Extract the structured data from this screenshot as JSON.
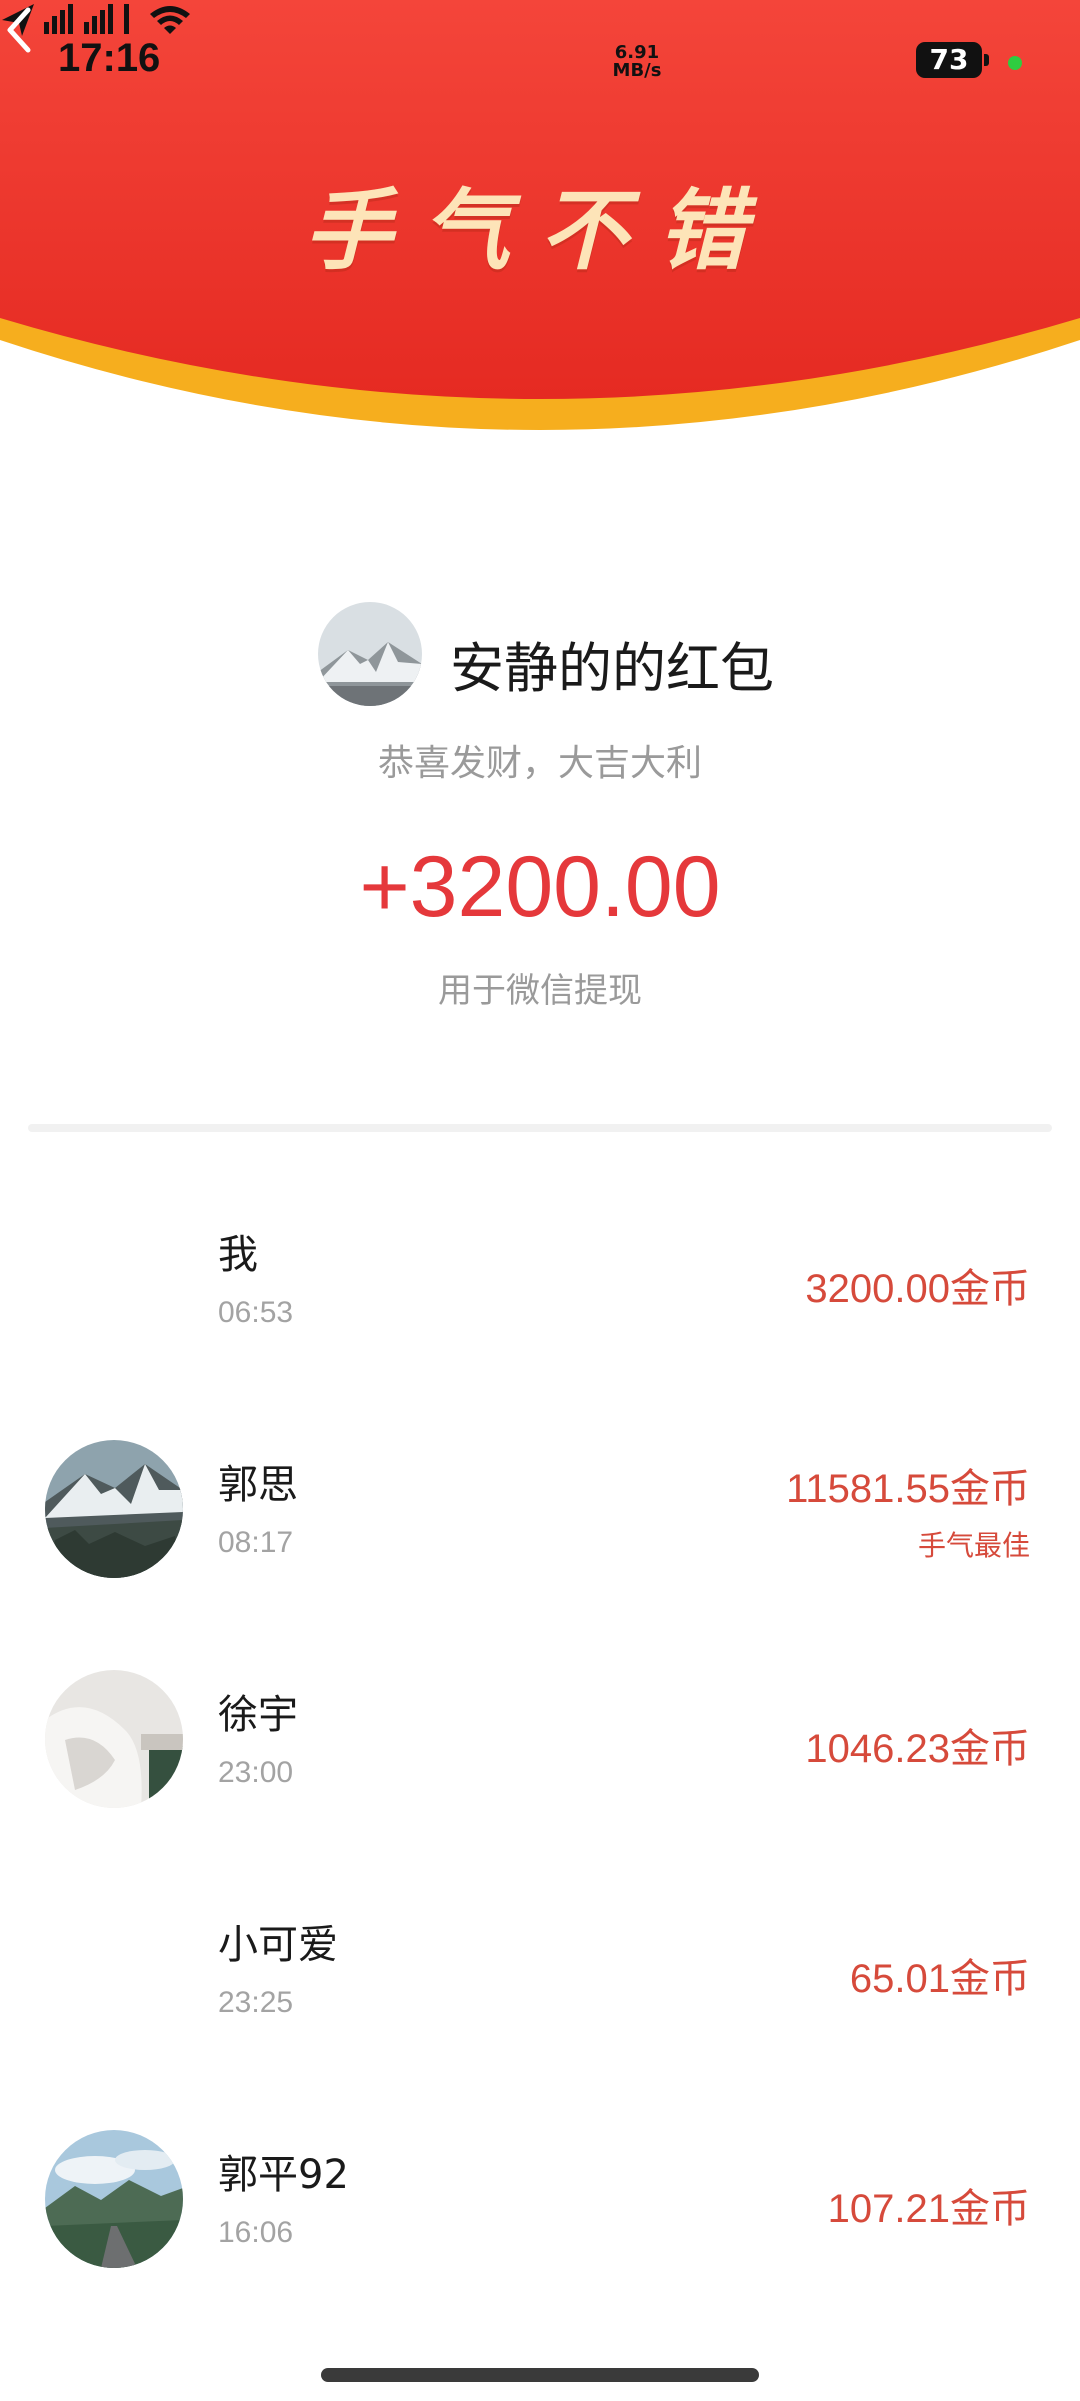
{
  "status_bar": {
    "time": "17:16",
    "speed_value": "6.91",
    "speed_unit": "MB/s",
    "battery": "73",
    "icons": [
      "location-arrow-icon",
      "signal-bars-icon",
      "wifi-icon",
      "battery-icon",
      "privacy-dot-icon"
    ]
  },
  "header": {
    "title": "手气不错",
    "back_icon": "chevron-left-icon",
    "colors": {
      "red": "#ea2a23",
      "gold": "#f7b11b",
      "title": "#fde4b8"
    }
  },
  "sender": {
    "name": "安静的的红包",
    "greeting": "恭喜发财，大吉大利",
    "amount": "+3200.00",
    "usage": "用于微信提现"
  },
  "records": [
    {
      "name": "我",
      "time": "06:53",
      "amount": "3200.00金币",
      "badge": "",
      "avatar": "none"
    },
    {
      "name": "郭思",
      "time": "08:17",
      "amount": "11581.55金币",
      "badge": "手气最佳",
      "avatar": "snowy-mountain"
    },
    {
      "name": "徐宇",
      "time": "23:00",
      "amount": "1046.23金币",
      "badge": "",
      "avatar": "white-cloth-photo"
    },
    {
      "name": "小可爱",
      "time": "23:25",
      "amount": "65.01金币",
      "badge": "",
      "avatar": "none"
    },
    {
      "name": "郭平92",
      "time": "16:06",
      "amount": "107.21金币",
      "badge": "",
      "avatar": "mountain-road"
    }
  ],
  "colors": {
    "amount": "#e5383b",
    "list_amount": "#d64a3b",
    "muted": "#9a9a9a"
  }
}
